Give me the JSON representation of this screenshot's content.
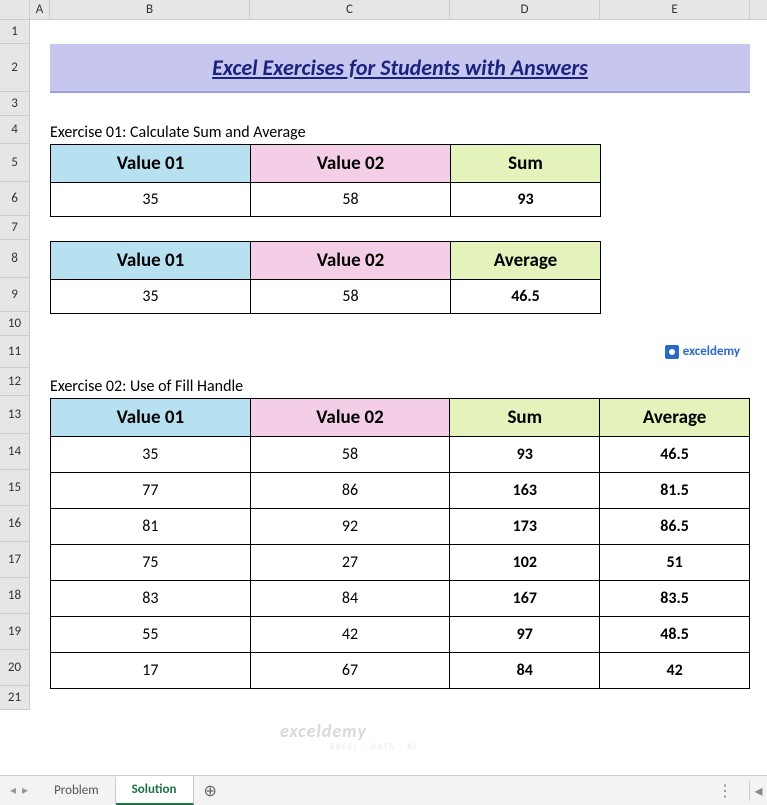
{
  "columns": {
    "A": "A",
    "B": "B",
    "C": "C",
    "D": "D",
    "E": "E"
  },
  "rows": {
    "r1": "1",
    "r2": "2",
    "r3": "3",
    "r4": "4",
    "r5": "5",
    "r6": "6",
    "r7": "7",
    "r8": "8",
    "r9": "9",
    "r10": "10",
    "r11": "11",
    "r12": "12",
    "r13": "13",
    "r14": "14",
    "r15": "15",
    "r16": "16",
    "r17": "17",
    "r18": "18",
    "r19": "19",
    "r20": "20",
    "r21": "21"
  },
  "title": "Excel Exercises for Students with Answers",
  "ex01": {
    "label": "Exercise 01: Calculate Sum and Average",
    "headers": {
      "v1": "Value 01",
      "v2": "Value 02",
      "sum": "Sum",
      "avg": "Average"
    },
    "row_sum": {
      "v1": "35",
      "v2": "58",
      "res": "93"
    },
    "row_avg": {
      "v1": "35",
      "v2": "58",
      "res": "46.5"
    }
  },
  "logo": {
    "text": "exceldemy"
  },
  "ex02": {
    "label": "Exercise 02: Use of Fill Handle",
    "headers": {
      "v1": "Value 01",
      "v2": "Value 02",
      "sum": "Sum",
      "avg": "Average"
    },
    "rows": [
      {
        "v1": "35",
        "v2": "58",
        "sum": "93",
        "avg": "46.5"
      },
      {
        "v1": "77",
        "v2": "86",
        "sum": "163",
        "avg": "81.5"
      },
      {
        "v1": "81",
        "v2": "92",
        "sum": "173",
        "avg": "86.5"
      },
      {
        "v1": "75",
        "v2": "27",
        "sum": "102",
        "avg": "51"
      },
      {
        "v1": "83",
        "v2": "84",
        "sum": "167",
        "avg": "83.5"
      },
      {
        "v1": "55",
        "v2": "42",
        "sum": "97",
        "avg": "48.5"
      },
      {
        "v1": "17",
        "v2": "67",
        "sum": "84",
        "avg": "42"
      }
    ]
  },
  "watermark": {
    "main": "exceldemy",
    "sub": "EXCEL · DATA · BI"
  },
  "tabs": {
    "nav_prev": "◂",
    "nav_next": "▸",
    "problem": "Problem",
    "solution": "Solution",
    "add": "⊕",
    "menu": "⋮",
    "scroll": "◂"
  },
  "chart_data": [
    {
      "type": "table",
      "title": "Exercise 01: Calculate Sum and Average (Sum)",
      "columns": [
        "Value 01",
        "Value 02",
        "Sum"
      ],
      "rows": [
        [
          35,
          58,
          93
        ]
      ]
    },
    {
      "type": "table",
      "title": "Exercise 01: Calculate Sum and Average (Average)",
      "columns": [
        "Value 01",
        "Value 02",
        "Average"
      ],
      "rows": [
        [
          35,
          58,
          46.5
        ]
      ]
    },
    {
      "type": "table",
      "title": "Exercise 02: Use of Fill Handle",
      "columns": [
        "Value 01",
        "Value 02",
        "Sum",
        "Average"
      ],
      "rows": [
        [
          35,
          58,
          93,
          46.5
        ],
        [
          77,
          86,
          163,
          81.5
        ],
        [
          81,
          92,
          173,
          86.5
        ],
        [
          75,
          27,
          102,
          51
        ],
        [
          83,
          84,
          167,
          83.5
        ],
        [
          55,
          42,
          97,
          48.5
        ],
        [
          17,
          67,
          84,
          42
        ]
      ]
    }
  ]
}
